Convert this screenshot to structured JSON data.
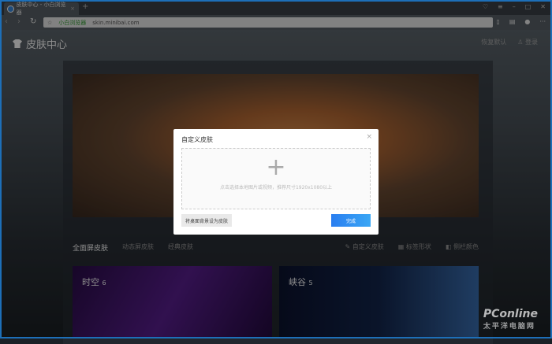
{
  "browser": {
    "tab_title": "皮肤中心 - 小白浏览器",
    "new_tab": "+",
    "tab_close": "×",
    "brand": "小白浏览器",
    "url": "skin.minibai.com"
  },
  "header": {
    "title": "皮肤中心",
    "restore": "恢复默认",
    "login": "登录"
  },
  "tabs": {
    "full": "全面屏皮肤",
    "dynamic": "动态屏皮肤",
    "classic": "经典皮肤",
    "custom": "自定义皮肤",
    "tab_shape": "标签形状",
    "sidebar_color": "侧栏颜色"
  },
  "cards": [
    {
      "name": "时空",
      "count": "6"
    },
    {
      "name": "峡谷",
      "count": "5"
    }
  ],
  "dialog": {
    "title": "自定义皮肤",
    "close": "×",
    "plus": "+",
    "hint": "点击选择本地图片或视频，推荐尺寸1920x1080以上",
    "set_desktop": "将桌面背景设为皮肤",
    "done": "完成"
  },
  "watermark": {
    "brand": "PConline",
    "sub": "太平洋电脑网"
  }
}
